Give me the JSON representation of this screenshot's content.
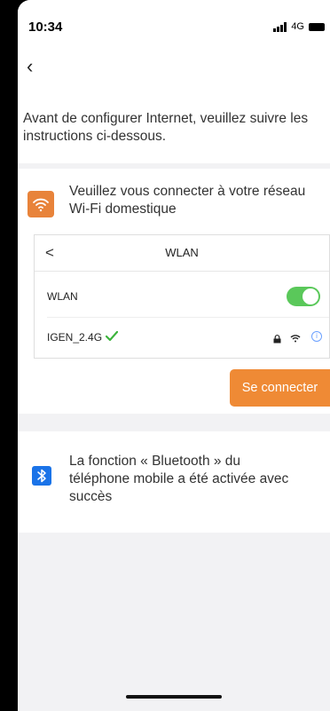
{
  "status_bar": {
    "time": "10:34",
    "network": "4G"
  },
  "nav": {
    "back_icon": "chevron-left-icon"
  },
  "instructions": {
    "text": "Avant de configurer Internet, veuillez suivre les instructions ci-dessous."
  },
  "wifi_step": {
    "icon": "wifi-icon",
    "icon_color": "#e8833a",
    "message": "Veuillez vous connecter à votre réseau Wi-Fi domestique",
    "panel": {
      "title": "WLAN",
      "wlan_label": "WLAN",
      "wlan_enabled": true,
      "network_name": "IGEN_2.4G",
      "network_connected": true
    },
    "connect_button": "Se connecter"
  },
  "bluetooth_step": {
    "icon": "bluetooth-icon",
    "icon_color": "#1a73e8",
    "message": "La fonction « Bluetooth » du téléphone mobile a été activée avec succès"
  },
  "colors": {
    "accent": "#ef8a35",
    "toggle_on": "#5ac85a",
    "background": "#f2f2f4"
  }
}
